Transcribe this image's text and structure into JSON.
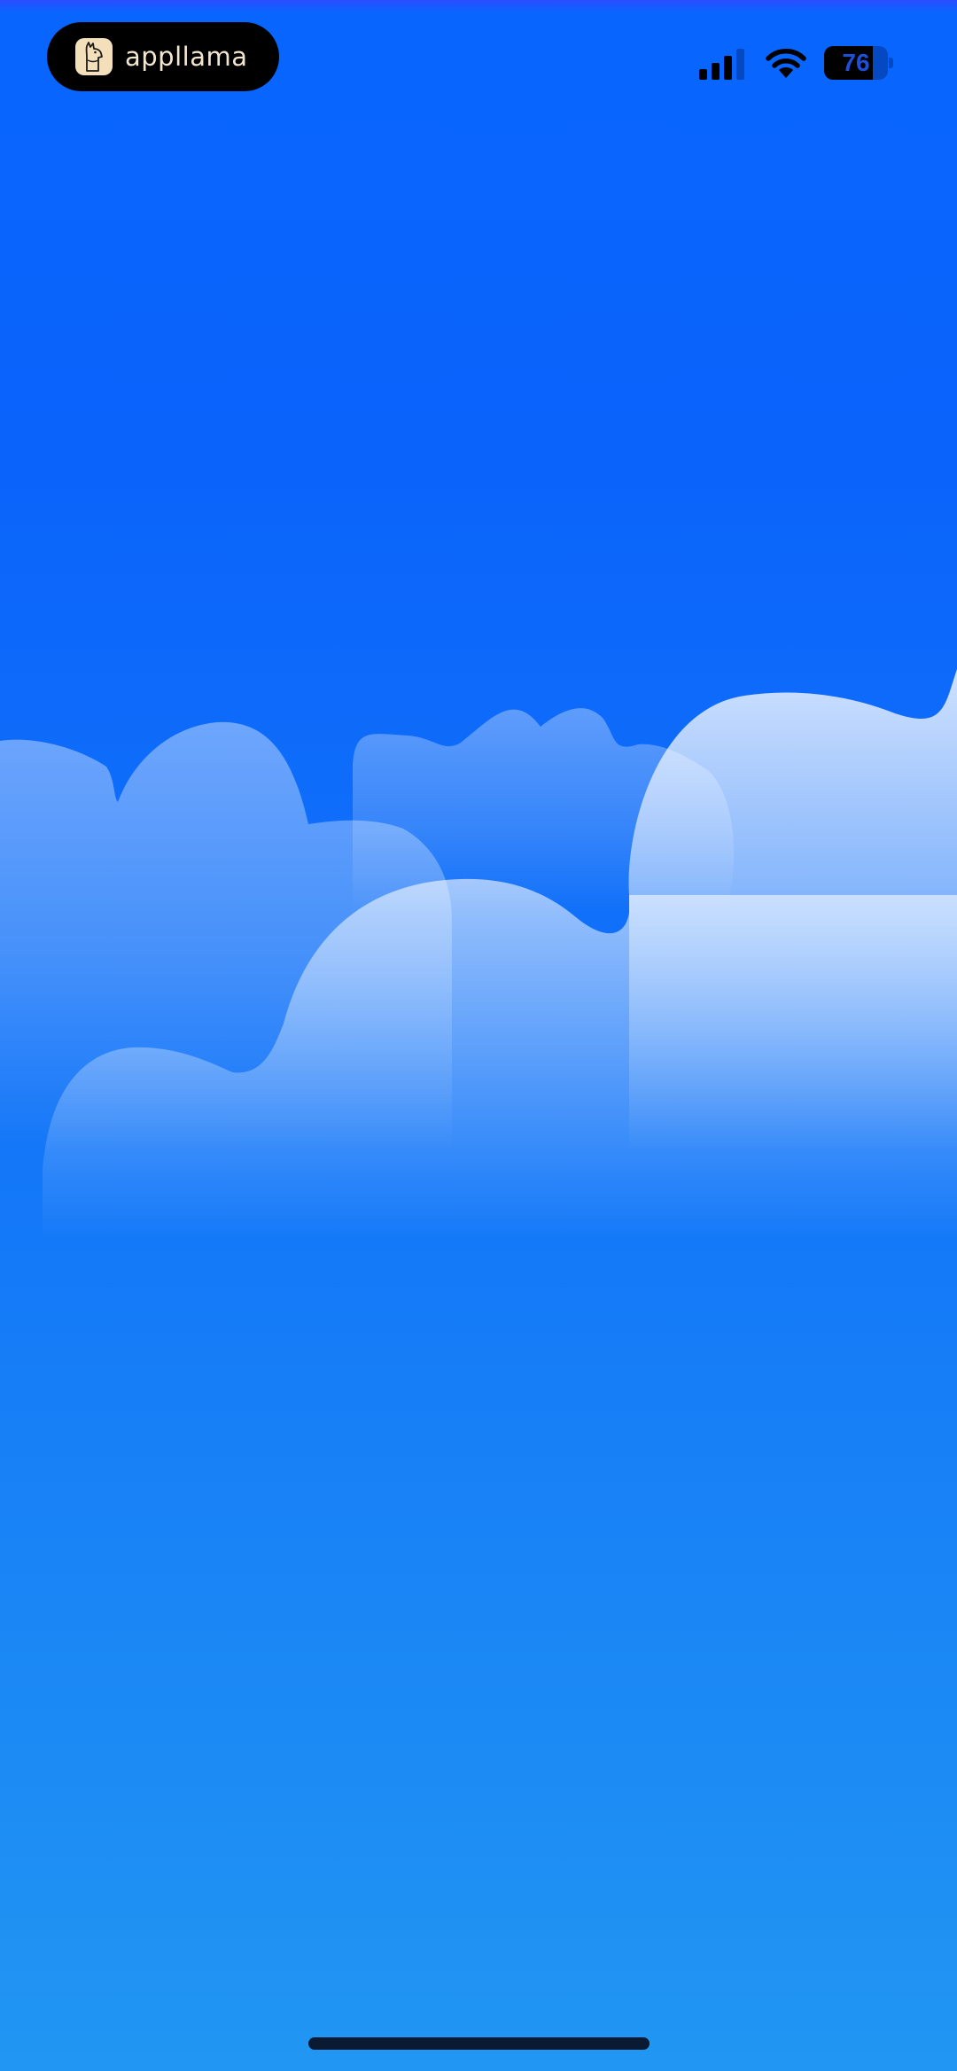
{
  "status_bar": {
    "app_badge": {
      "brand_name": "appllama",
      "logo_icon": "llama-icon"
    },
    "signal_icon": "cellular-signal-icon",
    "wifi_icon": "wifi-icon",
    "battery": {
      "level_text": "76",
      "level_fraction": 0.76
    }
  },
  "scene": {
    "background_top_color": "#0866ff",
    "background_bottom_color": "#2196f2",
    "cloud_color": "#cfe3ff"
  },
  "home_indicator_color": "#0a1a33"
}
